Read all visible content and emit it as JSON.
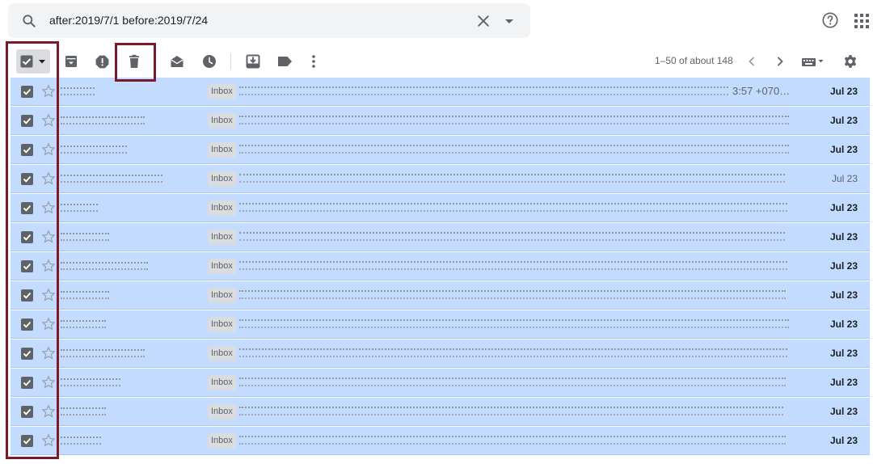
{
  "search": {
    "query": "after:2019/7/1 before:2019/7/24"
  },
  "toolbar": {
    "pagination": "1–50 of about 148"
  },
  "icons": [
    "search-icon",
    "clear-search-icon",
    "search-options-icon",
    "help-icon",
    "apps-icon",
    "select-all-checkbox",
    "dropdown-icon",
    "archive-icon",
    "report-spam-icon",
    "delete-icon",
    "mark-as-read-icon",
    "snooze-icon",
    "move-to-icon",
    "labels-icon",
    "more-icon",
    "chevron-left-icon",
    "chevron-right-icon",
    "keyboard-icon",
    "settings-icon",
    "star-icon"
  ],
  "colors": {
    "selected_row": "#c2dbff",
    "highlight_border": "#7b1a2b",
    "search_bg": "#f1f3f4"
  },
  "rows": [
    {
      "label": "Inbox",
      "date": "Jul 23",
      "extra": "3:57 +070…"
    },
    {
      "label": "Inbox",
      "date": "Jul 23"
    },
    {
      "label": "Inbox",
      "date": "Jul 23"
    },
    {
      "label": "Inbox",
      "date": "Jul 23"
    },
    {
      "label": "Inbox",
      "date": "Jul 23"
    },
    {
      "label": "Inbox",
      "date": "Jul 23"
    },
    {
      "label": "Inbox",
      "date": "Jul 23"
    },
    {
      "label": "Inbox",
      "date": "Jul 23"
    },
    {
      "label": "Inbox",
      "date": "Jul 23"
    },
    {
      "label": "Inbox",
      "date": "Jul 23"
    },
    {
      "label": "Inbox",
      "date": "Jul 23"
    },
    {
      "label": "Inbox",
      "date": "Jul 23"
    },
    {
      "label": "Inbox",
      "date": "Jul 23"
    }
  ]
}
